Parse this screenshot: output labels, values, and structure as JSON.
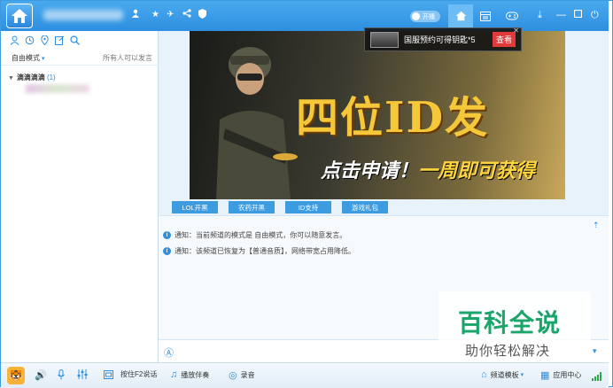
{
  "titlebar": {
    "online_count": "1",
    "toggle_label": "开播",
    "colors": {
      "accent": "#2e8fe0",
      "title_bg": "#3d9be0"
    }
  },
  "left_panel": {
    "mode_label": "自由模式",
    "mode_hint": "所有人可以发言",
    "channel_name": "滴滴滴滴",
    "channel_count": "(1)"
  },
  "banner": {
    "title": "四位ID发",
    "subtitle_prefix": "点击申请！",
    "subtitle_highlight": "一周即可获得"
  },
  "popup": {
    "text": "国服预约可得钥匙*5",
    "button": "查看"
  },
  "tags": [
    "LOL开黑",
    "农药开黑",
    "ID支持",
    "游戏礼包"
  ],
  "notices": [
    "通知：当前频道的模式是 自由模式，你可以随意发言。",
    "通知：该频道已恢复为【普通音质】，网络带宽占用降低。"
  ],
  "watermark": {
    "title": "百科全说",
    "subtitle": "助你轻松解决"
  },
  "bottombar": {
    "ptt_label": "按住F2说话",
    "music_label": "播放伴奏",
    "record_label": "录音",
    "template_label": "频道模板",
    "appcenter_label": "应用中心"
  }
}
